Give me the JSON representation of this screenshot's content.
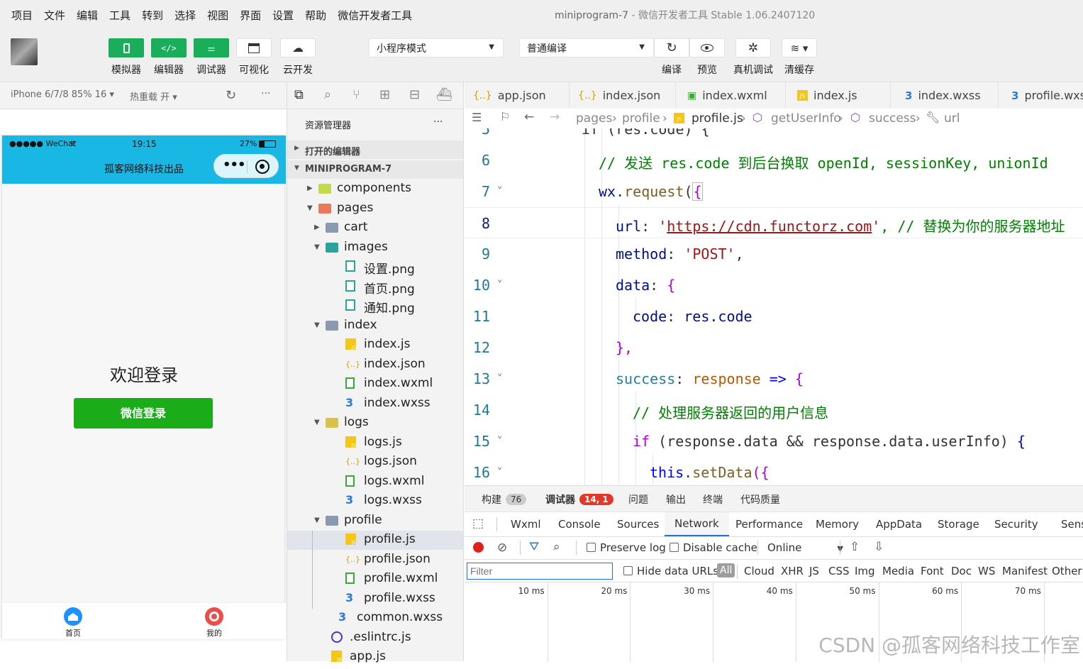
{
  "menu": [
    "项目",
    "文件",
    "编辑",
    "工具",
    "转到",
    "选择",
    "视图",
    "界面",
    "设置",
    "帮助",
    "微信开发者工具"
  ],
  "window_title": {
    "project": "miniprogram-7",
    "sep": " - ",
    "app": "微信开发者工具 Stable 1.06.2407120"
  },
  "toolbar": {
    "simulator": "模拟器",
    "editor": "编辑器",
    "debugger": "调试器",
    "visual": "可视化",
    "cloud": "云开发",
    "mode_select": "小程序模式",
    "compile_select": "普通编译",
    "compile": "编译",
    "preview": "预览",
    "remote_debug": "真机调试",
    "clear_cache": "清缓存"
  },
  "sim_header": {
    "device": "iPhone 6/7/8 85% 16",
    "hot_reload": "热重载 开",
    "more": "···"
  },
  "phone": {
    "carrier": "●●●●● WeChat",
    "time": "19:15",
    "battery": "27%",
    "nav_title": "孤客网络科技出品",
    "welcome": "欢迎登录",
    "login_button": "微信登录",
    "tabs": [
      "首页",
      "我的"
    ],
    "colors": {
      "nav": "#19b8e4",
      "login": "#1aad19",
      "tab_home": "#1e90ff",
      "tab_mine": "#f04b4b"
    }
  },
  "explorer": {
    "title": "资源管理器",
    "more": "···",
    "open_editors": "打开的编辑器",
    "project": "MINIPROGRAM-7",
    "items": [
      {
        "label": "components",
        "type": "folder-green"
      },
      {
        "label": "pages",
        "type": "folder-red"
      },
      {
        "label": "cart",
        "type": "folder"
      },
      {
        "label": "images",
        "type": "folder-teal"
      },
      {
        "label": "设置.png",
        "type": "img"
      },
      {
        "label": "首页.png",
        "type": "img"
      },
      {
        "label": "通知.png",
        "type": "img"
      },
      {
        "label": "index",
        "type": "folder"
      },
      {
        "label": "index.js",
        "type": "js"
      },
      {
        "label": "index.json",
        "type": "json"
      },
      {
        "label": "index.wxml",
        "type": "wxml"
      },
      {
        "label": "index.wxss",
        "type": "wxss"
      },
      {
        "label": "logs",
        "type": "folder-yellow"
      },
      {
        "label": "logs.js",
        "type": "js"
      },
      {
        "label": "logs.json",
        "type": "json"
      },
      {
        "label": "logs.wxml",
        "type": "wxml"
      },
      {
        "label": "logs.wxss",
        "type": "wxss"
      },
      {
        "label": "profile",
        "type": "folder"
      },
      {
        "label": "profile.js",
        "type": "js"
      },
      {
        "label": "profile.json",
        "type": "json"
      },
      {
        "label": "profile.wxml",
        "type": "wxml"
      },
      {
        "label": "profile.wxss",
        "type": "wxss"
      },
      {
        "label": "common.wxss",
        "type": "wxss"
      },
      {
        "label": ".eslintrc.js",
        "type": "eslint"
      },
      {
        "label": "app.js",
        "type": "js"
      }
    ]
  },
  "editor_tabs": [
    "app.json",
    "index.json",
    "index.wxml",
    "index.js",
    "index.wxss",
    "profile.wxs"
  ],
  "breadcrumb": [
    "pages",
    "profile",
    "profile.js",
    "getUserInfo",
    "success",
    "url"
  ],
  "code": {
    "partial_top": "if (res.code) {",
    "partial_num": "5",
    "lines": [
      {
        "n": "6"
      },
      {
        "n": "7"
      },
      {
        "n": "8"
      },
      {
        "n": "9"
      },
      {
        "n": "10"
      },
      {
        "n": "11"
      },
      {
        "n": "12"
      },
      {
        "n": "13"
      },
      {
        "n": "14"
      },
      {
        "n": "15"
      },
      {
        "n": "16"
      }
    ],
    "l6": "// 发送 res.code 到后台换取 openId, sessionKey, unionId",
    "l7a": "wx",
    "l7b": ".",
    "l7c": "request",
    "l7d": "(",
    "l7e": "{",
    "l8a": "url",
    "l8b": ": ",
    "l8c": "'",
    "l8d": "https://cdn.functorz.com",
    "l8e": "'",
    ", l8f": "",
    "l8comment": ", // 替换为你的服务器地址",
    "l9a": "method",
    "l9b": ": ",
    "l9c": "'POST'",
    "l9d": ",",
    "l10a": "data",
    "l10b": ": ",
    "l10c": "{",
    "l11a": "code",
    "l11b": ": ",
    "l11c": "res.code",
    "l12": "},",
    "l13a": "success",
    "l13b": ": ",
    "l13c": "response",
    "l13d": " => ",
    "l13e": "{",
    "l14": "// 处理服务器返回的用户信息",
    "l15a": "if",
    "l15b": " (response.data && response.data.userInfo) ",
    "l15c": "{",
    "l16a": "this",
    "l16b": ".",
    "l16c": "setData",
    "l16d": "({"
  },
  "devtools": {
    "tabs": [
      {
        "label": "构建",
        "badge": "76"
      },
      {
        "label": "调试器",
        "badge": "14, 1"
      },
      {
        "label": "问题"
      },
      {
        "label": "输出"
      },
      {
        "label": "终端"
      },
      {
        "label": "代码质量"
      }
    ],
    "chrome_tabs": [
      "Wxml",
      "Console",
      "Sources",
      "Network",
      "Performance",
      "Memory",
      "AppData",
      "Storage",
      "Security",
      "Sens"
    ],
    "preserve_log": "Preserve log",
    "disable_cache": "Disable cache",
    "throttle": "Online",
    "filter_placeholder": "Filter",
    "hide_data_urls": "Hide data URLs",
    "type_filters": [
      "All",
      "Cloud",
      "XHR",
      "JS",
      "CSS",
      "Img",
      "Media",
      "Font",
      "Doc",
      "WS",
      "Manifest",
      "Other"
    ],
    "ticks": [
      "10 ms",
      "20 ms",
      "30 ms",
      "40 ms",
      "50 ms",
      "60 ms",
      "70 ms"
    ]
  },
  "watermark": "CSDN @孤客网络科技工作室"
}
